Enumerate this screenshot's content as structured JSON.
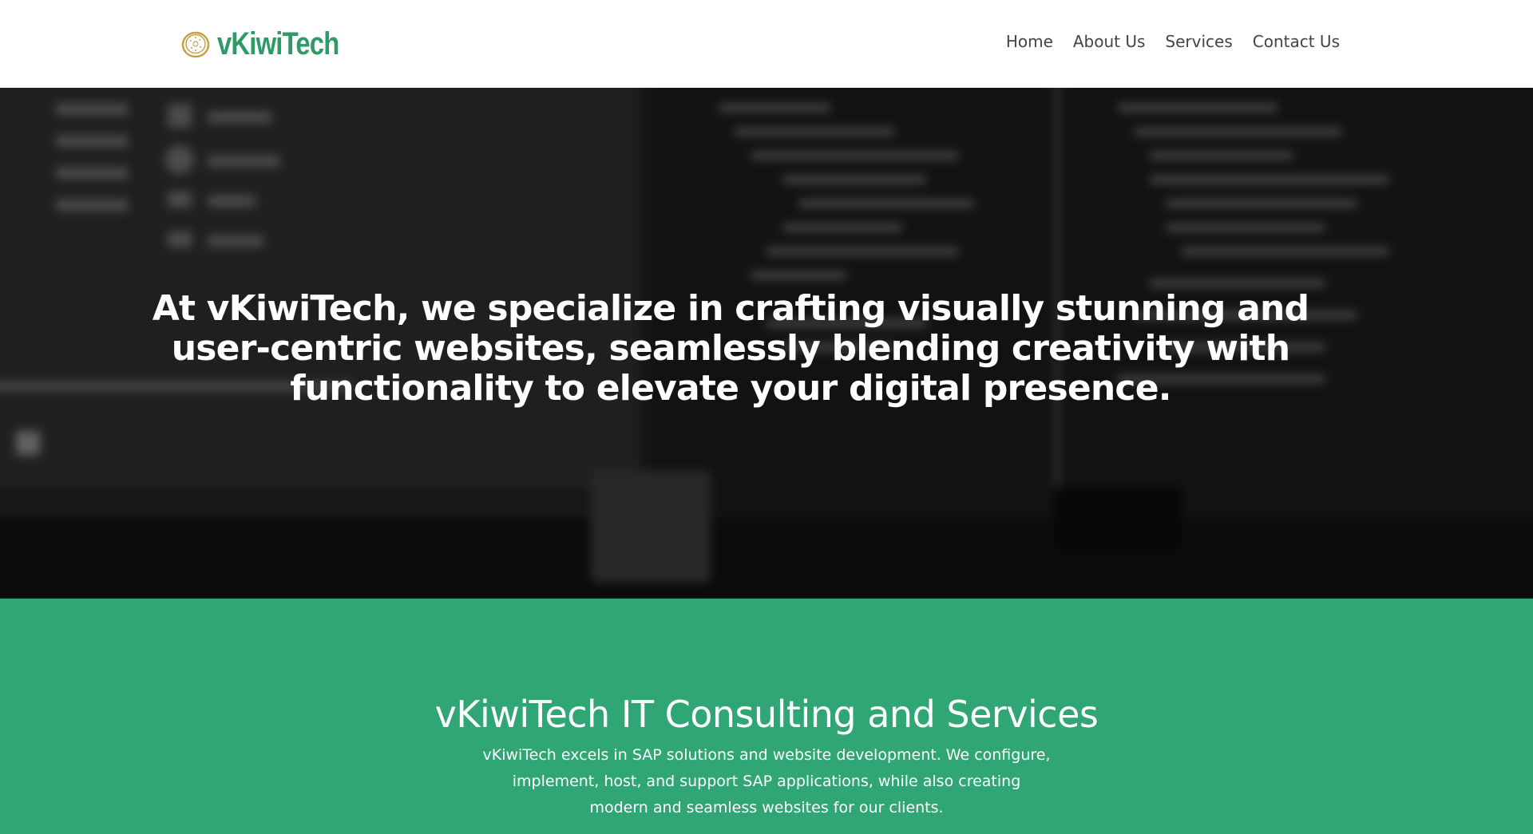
{
  "brand": {
    "logo_text": "vKiwiTech",
    "icon": "kiwi-slice-icon",
    "color": "#2e9a66",
    "icon_color": "#c8a24a"
  },
  "nav": {
    "items": [
      {
        "label": "Home"
      },
      {
        "label": "About Us"
      },
      {
        "label": "Services"
      },
      {
        "label": "Contact Us"
      }
    ]
  },
  "hero": {
    "line1": "At vKiwiTech, we specialize in crafting visually stunning and",
    "line2": "user-centric websites, seamlessly blending creativity with",
    "line3": "functionality to elevate your digital presence.",
    "background": "blurred monochrome code monitors photo"
  },
  "services": {
    "title": "vKiwiTech IT Consulting and Services",
    "desc_line1": "vKiwiTech excels in SAP solutions and website development. We configure,",
    "desc_line2": "implement, host, and support SAP applications, while also creating",
    "desc_line3": "modern and seamless websites for our clients.",
    "background_color": "#2fa674"
  }
}
